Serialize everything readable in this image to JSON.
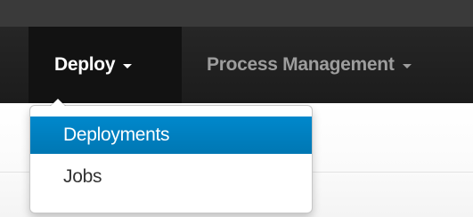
{
  "navbar": {
    "items": [
      {
        "label": "Deploy",
        "active": true,
        "has_caret": true
      },
      {
        "label": "Process Management",
        "active": false,
        "has_caret": true
      }
    ]
  },
  "dropdown": {
    "items": [
      {
        "label": "Deployments",
        "highlighted": true
      },
      {
        "label": "Jobs",
        "highlighted": false
      }
    ]
  },
  "colors": {
    "navbar_bg": "#1c1c1c",
    "active_nav_bg": "#121212",
    "nav_text_inactive": "#9d9d9d",
    "highlight": "#0088cc",
    "menu_text": "#333333"
  }
}
